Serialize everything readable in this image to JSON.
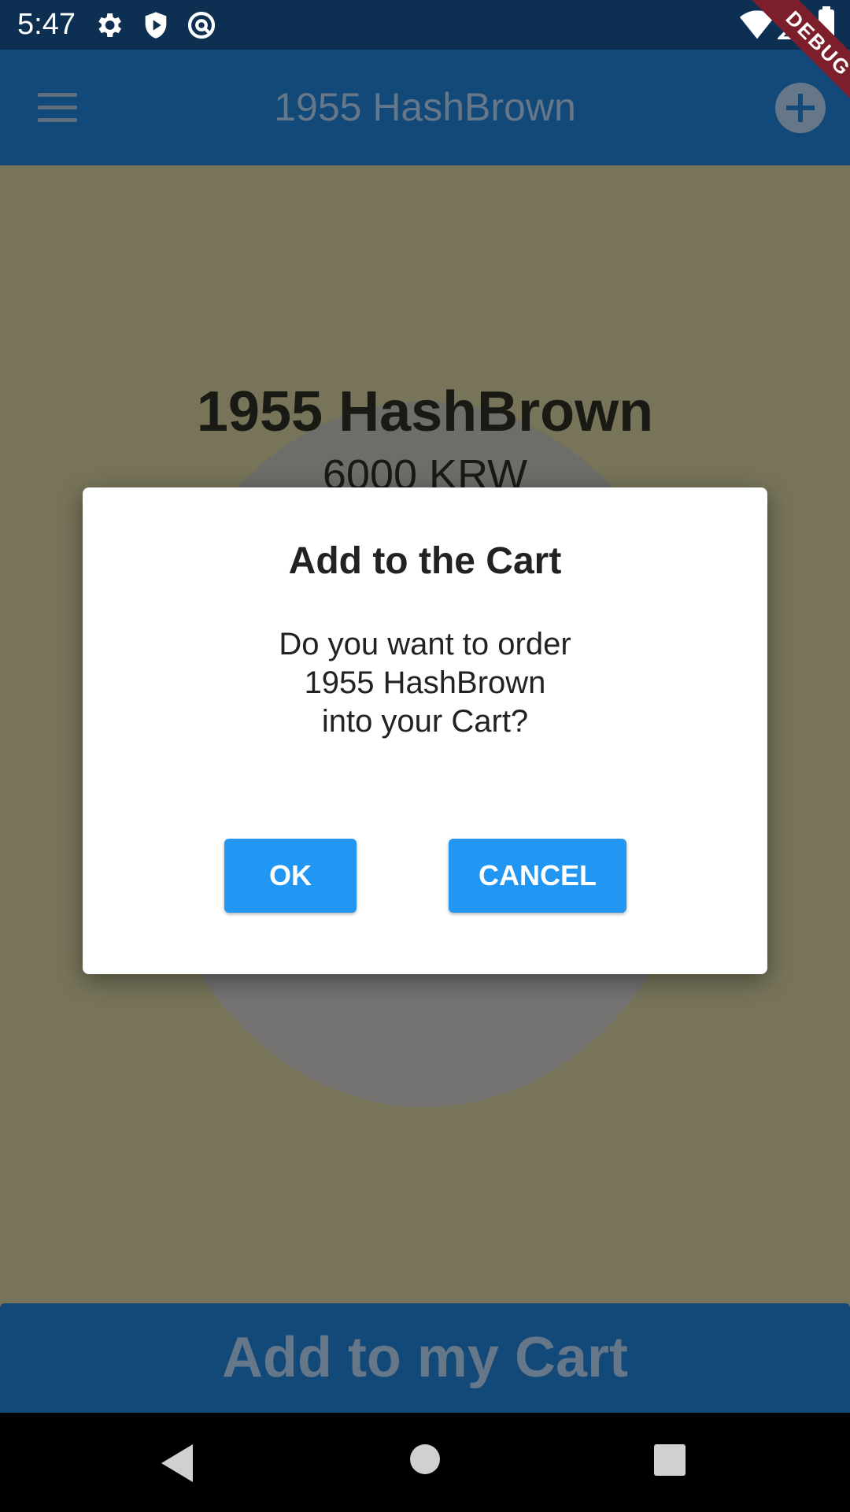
{
  "status_bar": {
    "time": "5:47",
    "icons": [
      "gear-icon",
      "shield-icon",
      "at-icon",
      "wifi-icon",
      "signal-icon",
      "battery-icon"
    ]
  },
  "debug_banner": "DEBUG",
  "app_bar": {
    "title": "1955 HashBrown",
    "menu_icon": "menu-icon",
    "action_icon": "add-circle-icon"
  },
  "product": {
    "name": "1955 HashBrown",
    "price": "6000 KRW"
  },
  "dialog": {
    "title": "Add to the Cart",
    "message_lines": [
      "Do you want to order",
      "1955 HashBrown",
      "into your Cart?"
    ],
    "ok_label": "OK",
    "cancel_label": "CANCEL"
  },
  "bottom_button": {
    "label": "Add to my Cart"
  },
  "colors": {
    "app_bar": "#134978",
    "status_bar": "#0d2f52",
    "dialog_button": "#2196f3",
    "scrim_background": "#77745a"
  }
}
